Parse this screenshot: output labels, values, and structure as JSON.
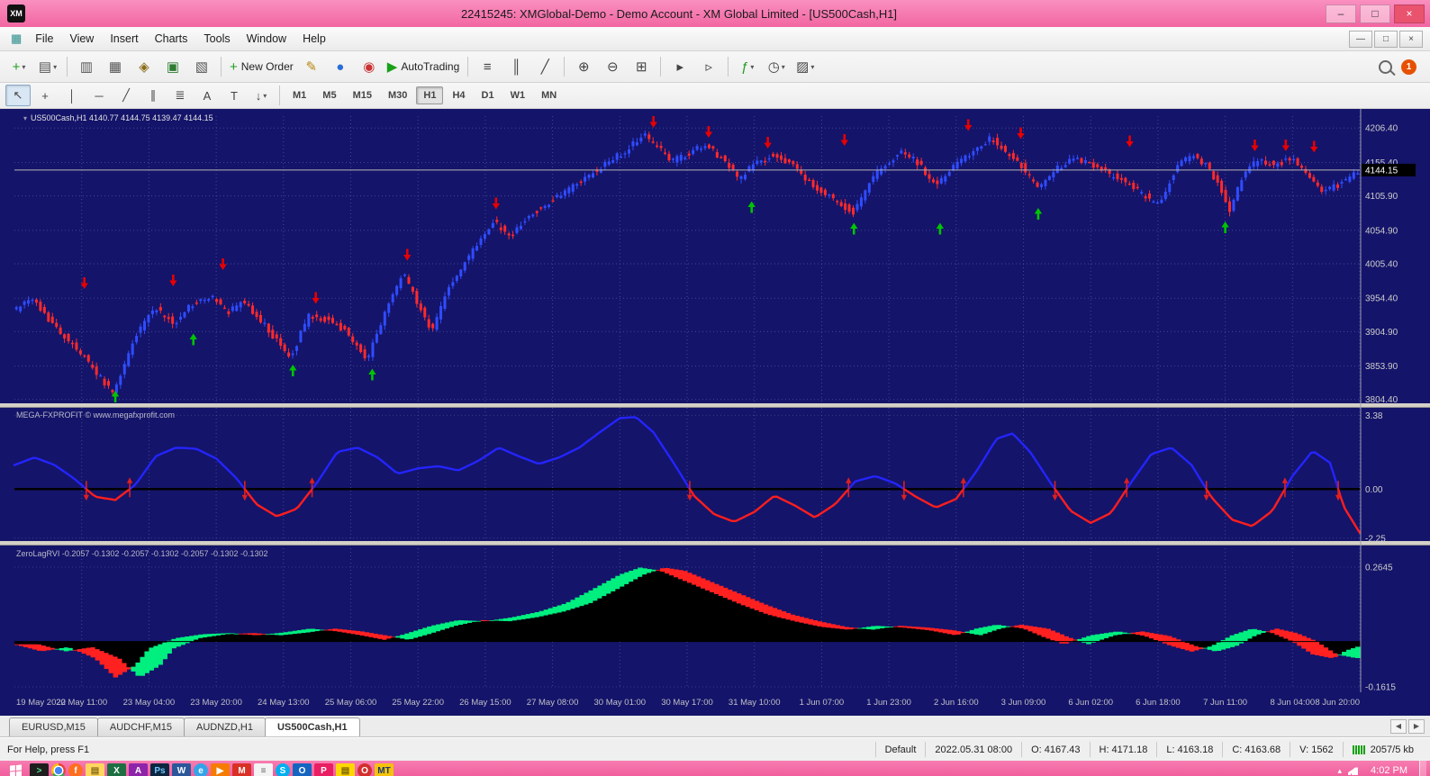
{
  "window": {
    "logo": "XM",
    "title": "22415245: XMGlobal-Demo - Demo Account - XM Global Limited - [US500Cash,H1]",
    "controls": {
      "minimize": "–",
      "restore": "□",
      "close": "×"
    },
    "mdi": {
      "minimize": "—",
      "restore": "□",
      "close": "×"
    }
  },
  "menu": {
    "document_icon": "▦",
    "items": [
      "File",
      "View",
      "Insert",
      "Charts",
      "Tools",
      "Window",
      "Help"
    ]
  },
  "toolbar_main": {
    "items": [
      {
        "name": "new-chart",
        "glyph": "+",
        "color": "#1f9d1f",
        "caret": true
      },
      {
        "name": "profiles",
        "glyph": "▤",
        "color": "#555",
        "caret": true
      },
      {
        "sep": true
      },
      {
        "name": "market-watch",
        "glyph": "▥",
        "color": "#555"
      },
      {
        "name": "data-window",
        "glyph": "▦",
        "color": "#555"
      },
      {
        "name": "navigator",
        "glyph": "◈",
        "color": "#8a6d1a"
      },
      {
        "name": "terminal",
        "glyph": "▣",
        "color": "#2e7d32"
      },
      {
        "name": "strategy-tester",
        "glyph": "▧",
        "color": "#555"
      },
      {
        "sep": true
      },
      {
        "name": "new-order",
        "glyph": "+",
        "color": "#1f9d1f",
        "label": "New Order"
      },
      {
        "name": "metaeditor",
        "glyph": "✎",
        "color": "#b8860b"
      },
      {
        "name": "mql5-community",
        "glyph": "●",
        "color": "#2a6fd6"
      },
      {
        "name": "market",
        "glyph": "◉",
        "color": "#c93434"
      },
      {
        "name": "autotrading",
        "glyph": "▶",
        "color": "#18a018",
        "label": "AutoTrading"
      },
      {
        "sep": true
      },
      {
        "name": "chart-bars",
        "glyph": "≡",
        "color": "#444"
      },
      {
        "name": "chart-candlesticks",
        "glyph": "║",
        "color": "#444"
      },
      {
        "name": "chart-line",
        "glyph": "╱",
        "color": "#444"
      },
      {
        "sep": true
      },
      {
        "name": "zoom-in",
        "glyph": "⊕",
        "color": "#444"
      },
      {
        "name": "zoom-out",
        "glyph": "⊖",
        "color": "#444"
      },
      {
        "name": "tile-windows",
        "glyph": "⊞",
        "color": "#444"
      },
      {
        "sep": true
      },
      {
        "name": "auto-scroll",
        "glyph": "▸",
        "color": "#444"
      },
      {
        "name": "chart-shift",
        "glyph": "▹",
        "color": "#444"
      },
      {
        "sep": true
      },
      {
        "name": "indicators",
        "glyph": "ƒ",
        "color": "#1f9d1f",
        "caret": true
      },
      {
        "name": "periods",
        "glyph": "◷",
        "color": "#444",
        "caret": true
      },
      {
        "name": "templates",
        "glyph": "▨",
        "color": "#444",
        "caret": true
      }
    ],
    "notification_count": "1"
  },
  "toolbar_drawing": {
    "items": [
      {
        "name": "cursor",
        "glyph": "↖",
        "active": true
      },
      {
        "name": "crosshair",
        "glyph": "+"
      },
      {
        "name": "vertical-line",
        "glyph": "│"
      },
      {
        "name": "horizontal-line",
        "glyph": "─"
      },
      {
        "name": "trendline",
        "glyph": "╱"
      },
      {
        "name": "equidistant-channel",
        "glyph": "∥"
      },
      {
        "name": "fibonacci-retracement",
        "glyph": "≣"
      },
      {
        "name": "text",
        "glyph": "A"
      },
      {
        "name": "text-label",
        "glyph": "T"
      },
      {
        "name": "arrows-tool",
        "glyph": "↓",
        "caret": true
      }
    ],
    "timeframes": [
      "M1",
      "M5",
      "M15",
      "M30",
      "H1",
      "H4",
      "D1",
      "W1",
      "MN"
    ],
    "active_timeframe": "H1"
  },
  "chart": {
    "collapse_glyph": "▾",
    "symbol_line": "US500Cash,H1  4140.77 4144.75 4139.47 4144.15",
    "indicator2_label": "MEGA-FXPROFIT © www.megafxprofit.com",
    "indicator3_label": "ZeroLagRVI -0.2057 -0.1302 -0.2057 -0.1302 -0.2057 -0.1302 -0.1302"
  },
  "chart_data": {
    "type": "candlestick-with-indicators",
    "symbol": "US500Cash,H1",
    "price_axis_labels": [
      "4206.40",
      "4155.40",
      "4105.90",
      "4054.90",
      "4005.40",
      "3954.40",
      "3904.90",
      "3853.90",
      "3804.40"
    ],
    "osc_axis_labels": [
      "3.38",
      "0.00",
      "-2.25"
    ],
    "rvi_axis_labels": [
      "0.2645",
      "-0.1615"
    ],
    "current_price": 4144.15,
    "current_price_label": "4144.15",
    "ranges": {
      "price": [
        3800,
        4224
      ],
      "osc": [
        -2.3,
        3.6
      ],
      "rvi": [
        -0.168,
        0.332
      ]
    },
    "time_labels": [
      "19 May 2022",
      "20 May 11:00",
      "23 May 04:00",
      "23 May 20:00",
      "24 May 13:00",
      "25 May 06:00",
      "25 May 22:00",
      "26 May 15:00",
      "27 May 08:00",
      "30 May 01:00",
      "30 May 17:00",
      "31 May 10:00",
      "1 Jun 07:00",
      "1 Jun 23:00",
      "2 Jun 16:00",
      "3 Jun 09:00",
      "6 Jun 02:00",
      "6 Jun 18:00",
      "7 Jun 11:00",
      "8 Jun 04:00",
      "8 Jun 20:00"
    ],
    "candle_count": 336,
    "price_anchors": [
      [
        0,
        3935
      ],
      [
        0.015,
        3952
      ],
      [
        0.03,
        3915
      ],
      [
        0.05,
        3875
      ],
      [
        0.075,
        3812
      ],
      [
        0.09,
        3895
      ],
      [
        0.105,
        3940
      ],
      [
        0.12,
        3918
      ],
      [
        0.135,
        3948
      ],
      [
        0.15,
        3958
      ],
      [
        0.16,
        3930
      ],
      [
        0.17,
        3952
      ],
      [
        0.185,
        3920
      ],
      [
        0.195,
        3895
      ],
      [
        0.207,
        3866
      ],
      [
        0.22,
        3930
      ],
      [
        0.235,
        3922
      ],
      [
        0.25,
        3902
      ],
      [
        0.263,
        3862
      ],
      [
        0.275,
        3922
      ],
      [
        0.29,
        3992
      ],
      [
        0.3,
        3952
      ],
      [
        0.312,
        3906
      ],
      [
        0.325,
        3975
      ],
      [
        0.34,
        4018
      ],
      [
        0.357,
        4068
      ],
      [
        0.37,
        4048
      ],
      [
        0.385,
        4078
      ],
      [
        0.4,
        4098
      ],
      [
        0.42,
        4125
      ],
      [
        0.44,
        4152
      ],
      [
        0.455,
        4172
      ],
      [
        0.47,
        4198
      ],
      [
        0.478,
        4180
      ],
      [
        0.49,
        4158
      ],
      [
        0.502,
        4168
      ],
      [
        0.515,
        4182
      ],
      [
        0.528,
        4160
      ],
      [
        0.54,
        4132
      ],
      [
        0.553,
        4155
      ],
      [
        0.566,
        4168
      ],
      [
        0.58,
        4150
      ],
      [
        0.595,
        4122
      ],
      [
        0.61,
        4100
      ],
      [
        0.625,
        4082
      ],
      [
        0.64,
        4135
      ],
      [
        0.652,
        4158
      ],
      [
        0.663,
        4172
      ],
      [
        0.675,
        4150
      ],
      [
        0.687,
        4120
      ],
      [
        0.7,
        4152
      ],
      [
        0.713,
        4168
      ],
      [
        0.727,
        4192
      ],
      [
        0.738,
        4172
      ],
      [
        0.75,
        4150
      ],
      [
        0.762,
        4118
      ],
      [
        0.775,
        4145
      ],
      [
        0.79,
        4162
      ],
      [
        0.803,
        4152
      ],
      [
        0.815,
        4138
      ],
      [
        0.828,
        4125
      ],
      [
        0.84,
        4108
      ],
      [
        0.852,
        4092
      ],
      [
        0.865,
        4148
      ],
      [
        0.877,
        4168
      ],
      [
        0.888,
        4150
      ],
      [
        0.898,
        4118
      ],
      [
        0.905,
        4085
      ],
      [
        0.915,
        4140
      ],
      [
        0.925,
        4158
      ],
      [
        0.938,
        4152
      ],
      [
        0.95,
        4160
      ],
      [
        0.96,
        4148
      ],
      [
        0.972,
        4112
      ],
      [
        0.985,
        4122
      ],
      [
        1,
        4140
      ]
    ],
    "buy_arrows": [
      [
        0.075,
        3806
      ],
      [
        0.133,
        3902
      ],
      [
        0.207,
        3856
      ],
      [
        0.266,
        3850
      ],
      [
        0.548,
        4098
      ],
      [
        0.624,
        4066
      ],
      [
        0.688,
        4066
      ],
      [
        0.761,
        4088
      ],
      [
        0.9,
        4068
      ]
    ],
    "sell_arrows": [
      [
        0.052,
        3968
      ],
      [
        0.118,
        3972
      ],
      [
        0.155,
        3996
      ],
      [
        0.224,
        3946
      ],
      [
        0.292,
        4010
      ],
      [
        0.358,
        4086
      ],
      [
        0.475,
        4212
      ],
      [
        0.516,
        4192
      ],
      [
        0.56,
        4176
      ],
      [
        0.617,
        4180
      ],
      [
        0.709,
        4202
      ],
      [
        0.748,
        4190
      ],
      [
        0.829,
        4178
      ],
      [
        0.922,
        4172
      ],
      [
        0.945,
        4172
      ],
      [
        0.966,
        4170
      ]
    ],
    "osc_anchors": [
      [
        0,
        1.1
      ],
      [
        0.015,
        1.45
      ],
      [
        0.03,
        1.1
      ],
      [
        0.045,
        0.45
      ],
      [
        0.06,
        -0.35
      ],
      [
        0.075,
        -0.5
      ],
      [
        0.09,
        0.2
      ],
      [
        0.105,
        1.5
      ],
      [
        0.12,
        1.9
      ],
      [
        0.135,
        1.85
      ],
      [
        0.15,
        1.4
      ],
      [
        0.165,
        0.5
      ],
      [
        0.18,
        -0.7
      ],
      [
        0.195,
        -1.25
      ],
      [
        0.21,
        -0.9
      ],
      [
        0.225,
        0.3
      ],
      [
        0.24,
        1.7
      ],
      [
        0.255,
        1.9
      ],
      [
        0.27,
        1.45
      ],
      [
        0.285,
        0.7
      ],
      [
        0.3,
        0.95
      ],
      [
        0.315,
        1.05
      ],
      [
        0.33,
        0.85
      ],
      [
        0.345,
        1.3
      ],
      [
        0.36,
        1.9
      ],
      [
        0.375,
        1.5
      ],
      [
        0.39,
        1.15
      ],
      [
        0.405,
        1.45
      ],
      [
        0.42,
        1.9
      ],
      [
        0.435,
        2.6
      ],
      [
        0.45,
        3.25
      ],
      [
        0.462,
        3.3
      ],
      [
        0.475,
        2.6
      ],
      [
        0.49,
        1.2
      ],
      [
        0.505,
        -0.3
      ],
      [
        0.52,
        -1.15
      ],
      [
        0.535,
        -1.5
      ],
      [
        0.55,
        -1.05
      ],
      [
        0.565,
        -0.3
      ],
      [
        0.58,
        -0.75
      ],
      [
        0.595,
        -1.3
      ],
      [
        0.61,
        -0.7
      ],
      [
        0.625,
        0.35
      ],
      [
        0.64,
        0.6
      ],
      [
        0.655,
        0.25
      ],
      [
        0.67,
        -0.35
      ],
      [
        0.685,
        -0.85
      ],
      [
        0.7,
        -0.45
      ],
      [
        0.715,
        0.8
      ],
      [
        0.73,
        2.3
      ],
      [
        0.742,
        2.55
      ],
      [
        0.755,
        1.7
      ],
      [
        0.77,
        0.3
      ],
      [
        0.785,
        -1.0
      ],
      [
        0.8,
        -1.55
      ],
      [
        0.815,
        -1.1
      ],
      [
        0.83,
        0.3
      ],
      [
        0.845,
        1.6
      ],
      [
        0.86,
        1.9
      ],
      [
        0.875,
        1.1
      ],
      [
        0.89,
        -0.4
      ],
      [
        0.905,
        -1.4
      ],
      [
        0.92,
        -1.7
      ],
      [
        0.935,
        -1.0
      ],
      [
        0.95,
        0.6
      ],
      [
        0.965,
        1.75
      ],
      [
        0.978,
        1.2
      ],
      [
        0.988,
        -0.8
      ],
      [
        1,
        -2.0
      ]
    ],
    "rvi_anchors": [
      [
        0,
        -0.01
      ],
      [
        0.02,
        -0.035
      ],
      [
        0.04,
        -0.02
      ],
      [
        0.06,
        -0.06
      ],
      [
        0.075,
        -0.128
      ],
      [
        0.09,
        -0.085
      ],
      [
        0.1,
        -0.025
      ],
      [
        0.12,
        0.012
      ],
      [
        0.14,
        0.026
      ],
      [
        0.16,
        0.03
      ],
      [
        0.18,
        0.022
      ],
      [
        0.2,
        0.032
      ],
      [
        0.22,
        0.046
      ],
      [
        0.24,
        0.036
      ],
      [
        0.26,
        0.02
      ],
      [
        0.275,
        0.006
      ],
      [
        0.29,
        0.026
      ],
      [
        0.31,
        0.056
      ],
      [
        0.33,
        0.076
      ],
      [
        0.35,
        0.072
      ],
      [
        0.37,
        0.086
      ],
      [
        0.39,
        0.106
      ],
      [
        0.41,
        0.136
      ],
      [
        0.43,
        0.186
      ],
      [
        0.45,
        0.238
      ],
      [
        0.465,
        0.263
      ],
      [
        0.48,
        0.252
      ],
      [
        0.5,
        0.212
      ],
      [
        0.52,
        0.172
      ],
      [
        0.54,
        0.132
      ],
      [
        0.56,
        0.096
      ],
      [
        0.58,
        0.072
      ],
      [
        0.6,
        0.052
      ],
      [
        0.62,
        0.042
      ],
      [
        0.64,
        0.056
      ],
      [
        0.66,
        0.05
      ],
      [
        0.68,
        0.04
      ],
      [
        0.7,
        0.022
      ],
      [
        0.715,
        0.046
      ],
      [
        0.73,
        0.06
      ],
      [
        0.75,
        0.046
      ],
      [
        0.765,
        0.016
      ],
      [
        0.78,
        -0.01
      ],
      [
        0.8,
        0.022
      ],
      [
        0.82,
        0.036
      ],
      [
        0.84,
        0.02
      ],
      [
        0.86,
        -0.016
      ],
      [
        0.875,
        -0.036
      ],
      [
        0.89,
        -0.016
      ],
      [
        0.905,
        0.022
      ],
      [
        0.92,
        0.046
      ],
      [
        0.935,
        0.03
      ],
      [
        0.95,
        0
      ],
      [
        0.965,
        -0.046
      ],
      [
        0.98,
        -0.06
      ],
      [
        0.99,
        -0.032
      ],
      [
        1,
        -0.016
      ]
    ],
    "rvi_signal_lag": 0.018,
    "colors": {
      "bg": "#14146a",
      "grid": "#5050a0",
      "axis_text": "#cdcdcd",
      "bull": "#2f4cff",
      "bear": "#ff2a2a",
      "buy_arrow": "#00c400",
      "sell_arrow": "#e60000",
      "osc_up": "#2424ff",
      "osc_down": "#ff1e1e",
      "osc_zero": "#000000",
      "osc_arrow": "#dd1f1f",
      "rvi_up": "#00ef7f",
      "rvi_down": "#ff2020",
      "rvi_base": "#000000",
      "price_line": "#b5b5b5",
      "price_tag_bg": "#000000",
      "price_tag_text": "#ffffff"
    }
  },
  "tabs": {
    "items": [
      "EURUSD,M15",
      "AUDCHF,M15",
      "AUDNZD,H1",
      "US500Cash,H1"
    ],
    "active_index": 3,
    "scroll_left": "◀",
    "scroll_right": "▶"
  },
  "status_bar": {
    "help": "For Help, press F1",
    "profile": "Default",
    "bar_time": "2022.05.31 08:00",
    "open": "O: 4167.43",
    "high": "H: 4171.18",
    "low": "L: 4163.18",
    "close": "C: 4163.68",
    "volume": "V: 1562",
    "traffic": "2057/5 kb"
  },
  "taskbar": {
    "time": "4:02 PM",
    "tray_chevron": "▴",
    "icons": [
      {
        "name": "console",
        "bg": "#1e1e1e",
        "fg": "#57e389",
        "glyph": ">"
      },
      {
        "name": "chrome",
        "kind": "chrome"
      },
      {
        "name": "firefox",
        "bg": "#ff6d1f",
        "fg": "#fff",
        "glyph": "f",
        "round": true
      },
      {
        "name": "file-explorer",
        "bg": "#ffd75e",
        "fg": "#8a6d1a",
        "glyph": "▤"
      },
      {
        "name": "excel",
        "bg": "#1d6f42",
        "fg": "#fff",
        "glyph": "X"
      },
      {
        "name": "access",
        "bg": "#8e24aa",
        "fg": "#fff",
        "glyph": "A"
      },
      {
        "name": "photoshop",
        "bg": "#0b2740",
        "fg": "#6fc3ff",
        "glyph": "Ps"
      },
      {
        "name": "word",
        "bg": "#2b579a",
        "fg": "#fff",
        "glyph": "W"
      },
      {
        "name": "internet-explorer",
        "bg": "#35a3e8",
        "fg": "#fff",
        "glyph": "e",
        "round": true
      },
      {
        "name": "media-player",
        "bg": "#f57c00",
        "fg": "#fff",
        "glyph": "▶"
      },
      {
        "name": "gmail",
        "bg": "#d93025",
        "fg": "#fff",
        "glyph": "M"
      },
      {
        "name": "notepad",
        "bg": "#f3f3f3",
        "fg": "#666",
        "glyph": "≡"
      },
      {
        "name": "skype",
        "bg": "#00aff0",
        "fg": "#fff",
        "glyph": "S",
        "round": true
      },
      {
        "name": "onedrive",
        "bg": "#1565c0",
        "fg": "#fff",
        "glyph": "O"
      },
      {
        "name": "paint",
        "bg": "#e91e63",
        "fg": "#fff",
        "glyph": "P"
      },
      {
        "name": "sticky-notes",
        "bg": "#ffd600",
        "fg": "#7a6400",
        "glyph": "▤"
      },
      {
        "name": "opera",
        "bg": "#d32f2f",
        "fg": "#fff",
        "glyph": "O",
        "round": true
      },
      {
        "name": "metatrader",
        "bg": "#f4c20d",
        "fg": "#1b3a6b",
        "glyph": "MT"
      }
    ]
  }
}
